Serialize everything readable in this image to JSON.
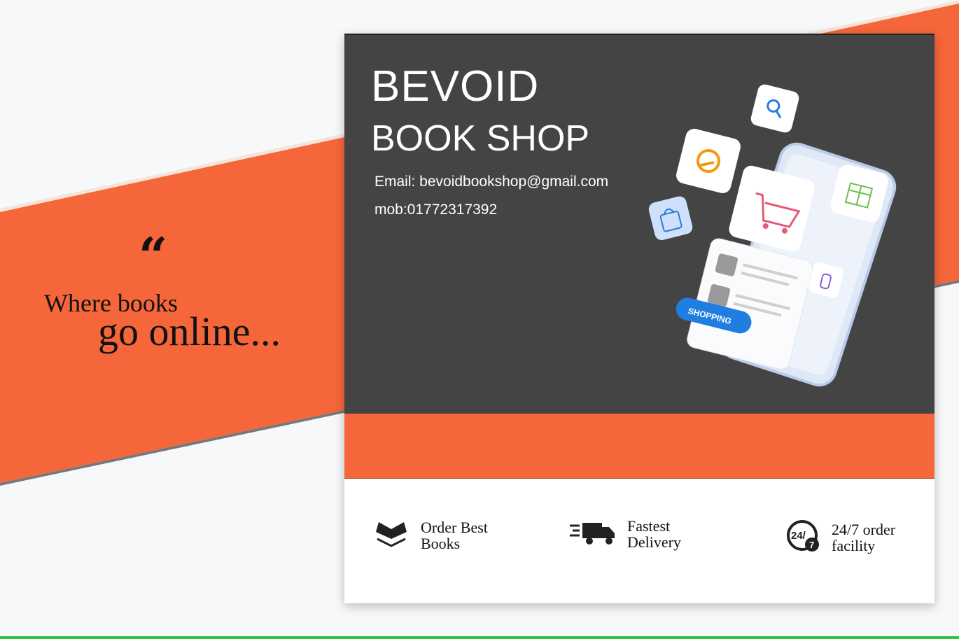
{
  "brand": {
    "name_line1": "BEVOID",
    "name_line2": "BOOK SHOP"
  },
  "contact": {
    "email": "Email: bevoidbookshop@gmail.com",
    "mobile": "mob:01772317392"
  },
  "tagline": {
    "quote_mark": "“",
    "line1": "Where books",
    "line2": "go online..."
  },
  "illustration": {
    "badge_text": "SHOPPING",
    "icons": [
      "search-icon",
      "globe-cart-icon",
      "shopping-cart-icon",
      "gift-icon",
      "shopping-bag-icon",
      "bottle-icon",
      "shirt-icon"
    ]
  },
  "features": [
    {
      "icon": "open-book-icon",
      "label": "Order Best\nBooks"
    },
    {
      "icon": "delivery-truck-icon",
      "label": "Fastest\nDelivery"
    },
    {
      "icon": "clock-24-7-icon",
      "label": "24/7 order\nfacility"
    }
  ],
  "colors": {
    "accent": "#f6663b",
    "dark_panel": "#444444",
    "background": "#f7f8fa",
    "bottom_line": "#34c23e"
  }
}
